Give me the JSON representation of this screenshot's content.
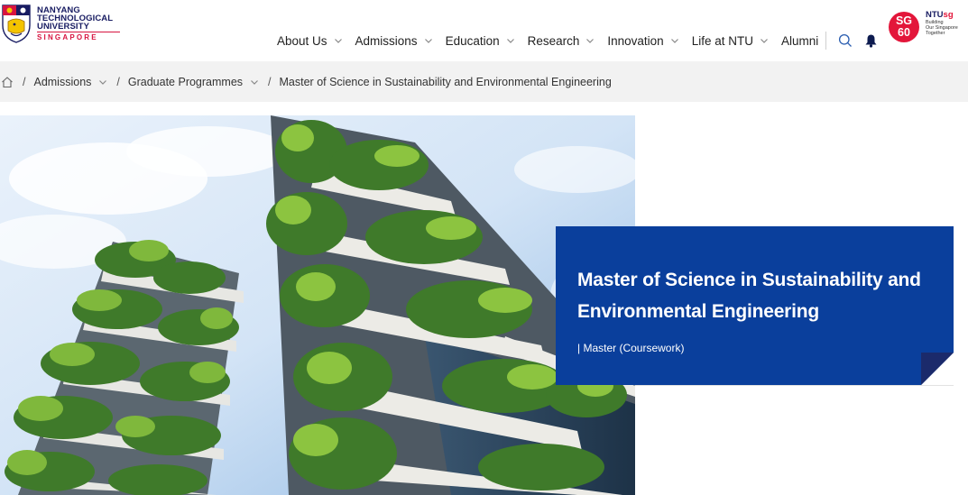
{
  "logo": {
    "line1": "NANYANG",
    "line2": "TECHNOLOGICAL",
    "line3": "UNIVERSITY",
    "line4": "SINGAPORE"
  },
  "nav": {
    "items": [
      {
        "label": "About Us",
        "has_dropdown": true
      },
      {
        "label": "Admissions",
        "has_dropdown": true
      },
      {
        "label": "Education",
        "has_dropdown": true
      },
      {
        "label": "Research",
        "has_dropdown": true
      },
      {
        "label": "Innovation",
        "has_dropdown": true
      },
      {
        "label": "Life at NTU",
        "has_dropdown": true
      },
      {
        "label": "Alumni",
        "has_dropdown": false
      }
    ],
    "icons": [
      "search-icon",
      "bell-icon"
    ]
  },
  "sg60": {
    "line1": "SG",
    "line2": "60",
    "brand_ntu": "NTU",
    "brand_sg": "sg",
    "tag1": "Building",
    "tag2": "Our Singapore",
    "tag3": "Together"
  },
  "breadcrumb": {
    "items": [
      "Admissions",
      "Graduate Programmes"
    ],
    "current": "Master of Science in Sustainability and Environmental Engineering"
  },
  "hero": {
    "title_line1": "Master of Science in Sustainability and",
    "title_line2": "Environmental Engineering",
    "subtitle": "| Master (Coursework)"
  },
  "colors": {
    "brand_navy": "#181c62",
    "brand_red": "#d71440",
    "card_blue": "#0a3f9c",
    "breadcrumb_bg": "#f2f2f2"
  }
}
